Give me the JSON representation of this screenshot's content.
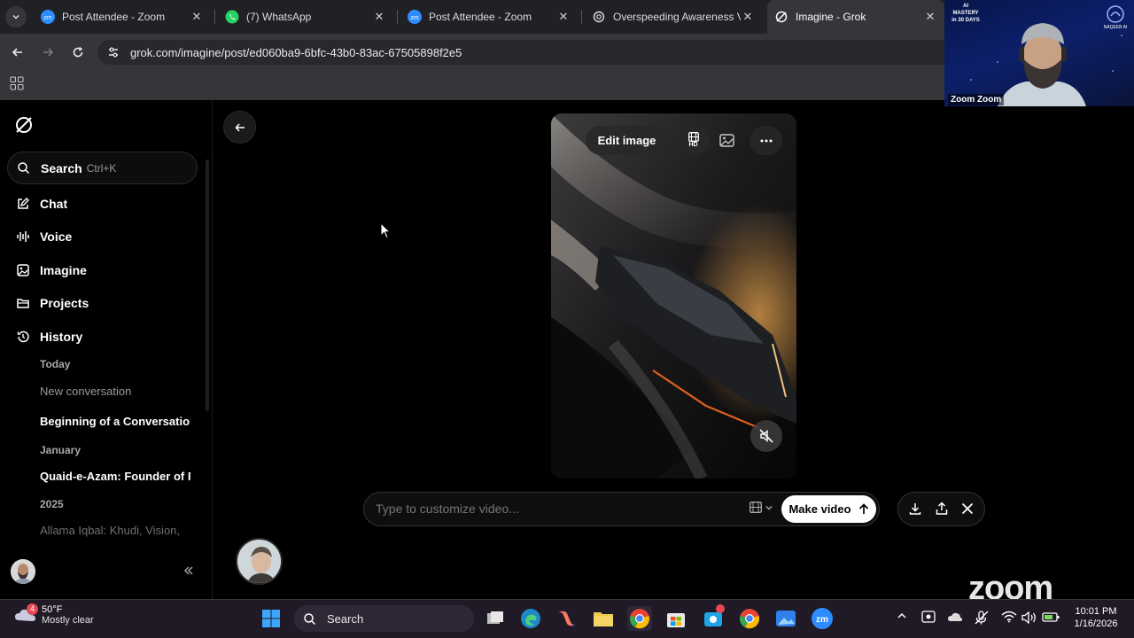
{
  "tabs": [
    {
      "title": "Post Attendee - Zoom",
      "icon": "zoom-icon"
    },
    {
      "title": "(7) WhatsApp",
      "icon": "whatsapp-icon"
    },
    {
      "title": "Post Attendee - Zoom",
      "icon": "zoom-icon"
    },
    {
      "title": "Overspeeding Awareness Vi",
      "icon": "chatgpt-icon"
    },
    {
      "title": "Imagine - Grok",
      "icon": "grok-icon"
    }
  ],
  "address": {
    "url": "grok.com/imagine/post/ed060ba9-6bfc-43b0-83ac-67505898f2e5"
  },
  "zoom_video": {
    "participant": "Zoom Zoom",
    "banner_left": [
      "AI",
      "MASTERY",
      "in 30 DAYS"
    ],
    "banner_right": "NAQEEB AI"
  },
  "sidebar": {
    "search_label": "Search",
    "search_shortcut": "Ctrl+K",
    "nav": [
      "Chat",
      "Voice",
      "Imagine",
      "Projects",
      "History"
    ],
    "history": {
      "today_label": "Today",
      "today_items": [
        "New conversation",
        "Beginning of a Conversation"
      ],
      "january_label": "January",
      "january_items": [
        "Quaid-e-Azam: Founder of Pakistan"
      ],
      "year_label": "2025",
      "year_items": [
        "Allama Iqbal: Khudi, Vision,"
      ]
    }
  },
  "image_panel": {
    "edit_label": "Edit image",
    "hd_label": "HD"
  },
  "prompt": {
    "placeholder": "Type to customize video...",
    "make_video_label": "Make video"
  },
  "zoom_logo": "zoom",
  "taskbar": {
    "weather_temp": "50°F",
    "weather_desc": "Mostly clear",
    "weather_badge": "4",
    "search_label": "Search",
    "time": "10:01 PM",
    "date": "1/16/2026"
  }
}
